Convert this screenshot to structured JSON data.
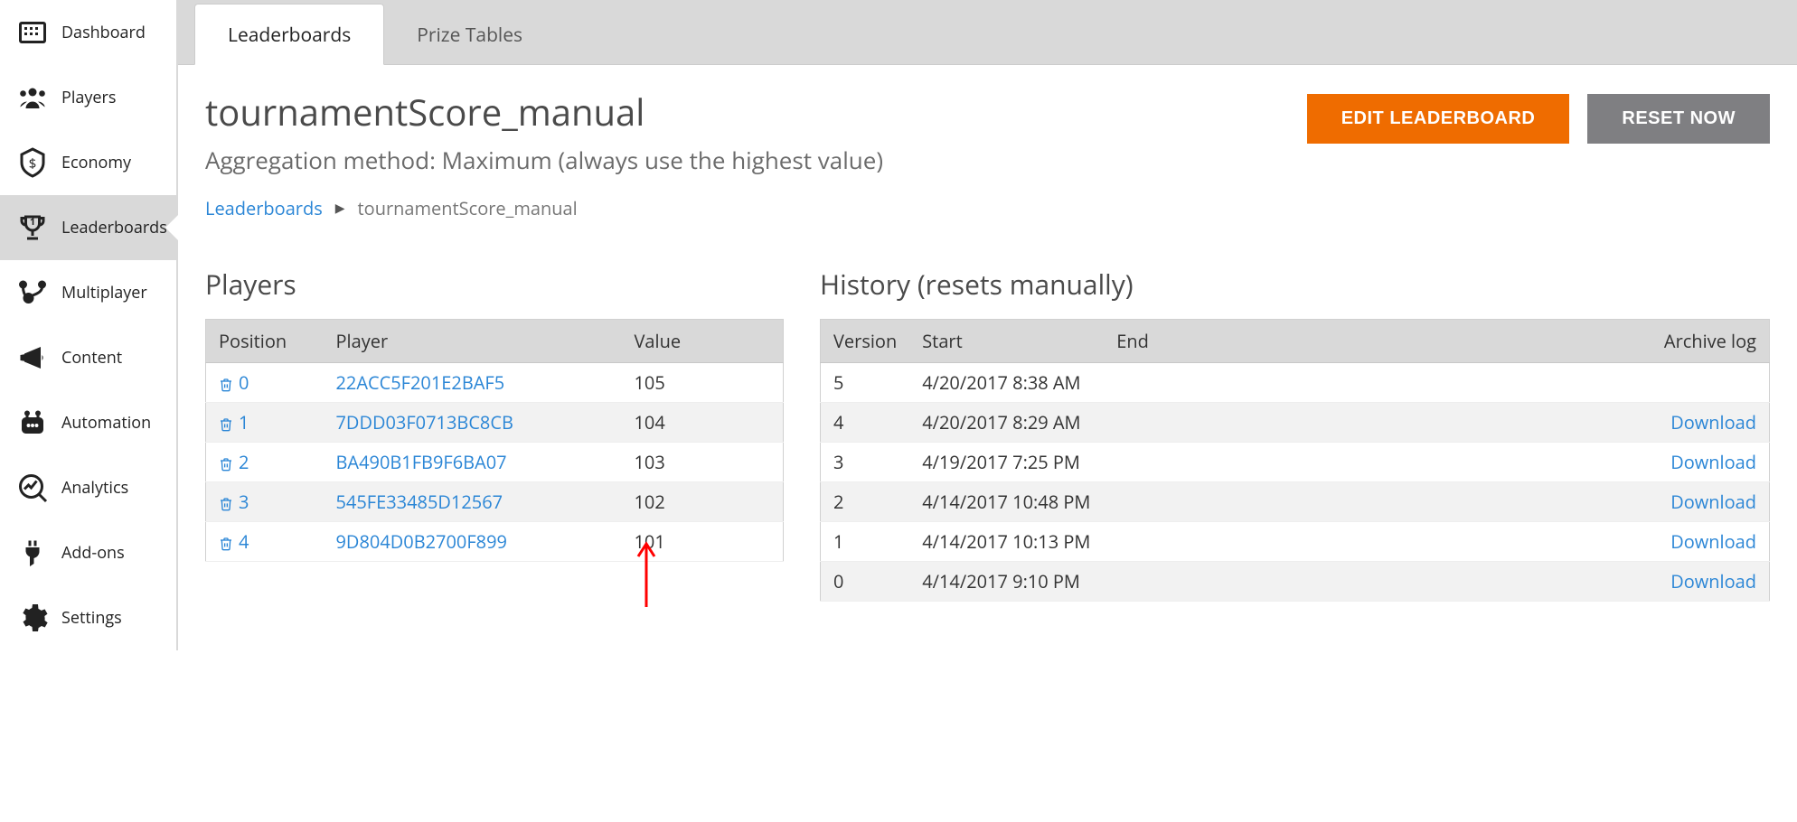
{
  "sidebar": {
    "items": [
      {
        "label": "Dashboard"
      },
      {
        "label": "Players"
      },
      {
        "label": "Economy"
      },
      {
        "label": "Leaderboards"
      },
      {
        "label": "Multiplayer"
      },
      {
        "label": "Content"
      },
      {
        "label": "Automation"
      },
      {
        "label": "Analytics"
      },
      {
        "label": "Add-ons"
      },
      {
        "label": "Settings"
      }
    ]
  },
  "tabs": [
    {
      "label": "Leaderboards"
    },
    {
      "label": "Prize Tables"
    }
  ],
  "header": {
    "title": "tournamentScore_manual",
    "subtitle": "Aggregation method: Maximum (always use the highest value)",
    "edit_button": "EDIT LEADERBOARD",
    "reset_button": "RESET NOW"
  },
  "breadcrumbs": {
    "root": "Leaderboards",
    "current": "tournamentScore_manual"
  },
  "players_panel": {
    "title": "Players",
    "headers": {
      "position": "Position",
      "player": "Player",
      "value": "Value"
    },
    "rows": [
      {
        "position": "0",
        "player": "22ACC5F201E2BAF5",
        "value": "105"
      },
      {
        "position": "1",
        "player": "7DDD03F0713BC8CB",
        "value": "104"
      },
      {
        "position": "2",
        "player": "BA490B1FB9F6BA07",
        "value": "103"
      },
      {
        "position": "3",
        "player": "545FE33485D12567",
        "value": "102"
      },
      {
        "position": "4",
        "player": "9D804D0B2700F899",
        "value": "101"
      }
    ]
  },
  "history_panel": {
    "title": "History (resets manually)",
    "headers": {
      "version": "Version",
      "start": "Start",
      "end": "End",
      "archive": "Archive log"
    },
    "download_label": "Download",
    "rows": [
      {
        "version": "5",
        "start": "4/20/2017 8:38 AM",
        "end": "",
        "download": false
      },
      {
        "version": "4",
        "start": "4/20/2017 8:29 AM",
        "end": "",
        "download": true
      },
      {
        "version": "3",
        "start": "4/19/2017 7:25 PM",
        "end": "",
        "download": true
      },
      {
        "version": "2",
        "start": "4/14/2017 10:48 PM",
        "end": "",
        "download": true
      },
      {
        "version": "1",
        "start": "4/14/2017 10:13 PM",
        "end": "",
        "download": true
      },
      {
        "version": "0",
        "start": "4/14/2017 9:10 PM",
        "end": "",
        "download": true
      }
    ]
  }
}
